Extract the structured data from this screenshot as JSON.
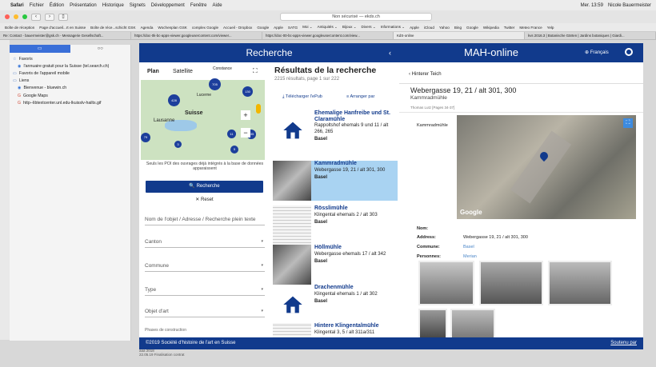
{
  "menubar": {
    "app": "Safari",
    "items": [
      "Fichier",
      "Édition",
      "Présentation",
      "Historique",
      "Signets",
      "Développement",
      "Fenêtre",
      "Aide"
    ],
    "clock": "Mer. 13:59",
    "user": "Nicole Bauermeister"
  },
  "toolbar": {
    "url": "Non sécurisé — ekds.ch"
  },
  "bookmarks": [
    "Boîte de réception",
    "Page d'accueil...rt en Suisse",
    "Boîte de réce...schicht GSK",
    "Agenda",
    "Wochenplan GSK",
    "complex Google",
    "Accueil - Dropbox",
    "Google",
    "Apple",
    "SATG",
    "Moi ⌄",
    "Antiquités ⌄",
    "Bijoux ⌄",
    "Divers ⌄",
    "Informations ⌄",
    "Apple",
    "iCloud",
    "Yahoo",
    "Bing",
    "Google",
    "Wikipedia",
    "Twitter",
    "Meteo France",
    "Yelp"
  ],
  "tabs": [
    {
      "label": "Re: Contact - bauermeister@gsk.ch - Messagerie Gesellschaft...",
      "active": false
    },
    {
      "label": "https://doc-0k-bc-apps-viewer.googleusercontent.com/viewer...",
      "active": false
    },
    {
      "label": "https://doc-00-bc-apps-viewer.googleusercontent.com/view...",
      "active": false
    },
    {
      "label": "KdS-online",
      "active": true
    },
    {
      "label": "kvs 2016.3 | Botanische Gärten | Jardins botaniques | Giardi...",
      "active": false
    }
  ],
  "sidebar": {
    "tab_icons": [
      "book-icon",
      "glasses-icon"
    ],
    "items": [
      {
        "label": "Favoris",
        "icon": "star-icon",
        "indent": 0
      },
      {
        "label": "l'annuaire gratuit pour la Suisse (tel.search.ch)",
        "icon": "globe-icon",
        "indent": 1
      },
      {
        "label": "Favoris de l'appareil mobile",
        "icon": "folder-icon",
        "indent": 0
      },
      {
        "label": "Liens",
        "icon": "folder-icon",
        "indent": 0
      },
      {
        "label": "Bienvenue - bluewin.ch",
        "icon": "globe-icon",
        "indent": 1
      },
      {
        "label": "Google Maps",
        "icon": "g-icon",
        "indent": 1
      },
      {
        "label": "http--libtextcenter.unl.edu-lkuisslv-hailts.gif",
        "icon": "g-icon",
        "indent": 1
      }
    ]
  },
  "search": {
    "header": "Recherche",
    "map_tabs": [
      "Plan",
      "Satellite"
    ],
    "map_labels": [
      "Lausanne",
      "Suisse",
      "Lucerne",
      "Constance"
    ],
    "clusters": [
      "705",
      "428",
      "130",
      "135",
      "11",
      "5",
      "79",
      "3"
    ],
    "map_note": "Seuls les POI des ouvrages déjà intégrés à la base de données apparaissent",
    "search_button": "Recherche",
    "reset_button": "Reset",
    "fields": {
      "text_placeholder": "Nom de l'objet / Adresse / Recherche plein texte",
      "canton": "Canton",
      "commune": "Commune",
      "type": "Type",
      "objet": "Objet d'art",
      "phases": "Phases de construction"
    }
  },
  "results": {
    "title": "Résultats de la recherche",
    "count": "2215 résultats, page 1 sur 222",
    "epub": "Télécharger l'ePub",
    "arrange": "Arranger par",
    "items": [
      {
        "title": "Ehemalige Hanfreibe und St. Claramühle",
        "address": "Rappoltshof ehemals 9 und 11 / alt 266, 265",
        "city": "Basel",
        "thumb": "house"
      },
      {
        "title": "Kammradmühle",
        "address": "Webergasse 19, 21 / alt 301, 300",
        "city": "Basel",
        "thumb": "photo"
      },
      {
        "title": "Rösslimühle",
        "address": "Klingental ehemals 2 / alt 303",
        "city": "Basel",
        "thumb": "drawing"
      },
      {
        "title": "Höllmühle",
        "address": "Webergasse ehemals 17 / alt 342",
        "city": "Basel",
        "thumb": "photo"
      },
      {
        "title": "Drachenmühle",
        "address": "Klingental ehemals 1 / alt 302",
        "city": "Basel",
        "thumb": "house"
      },
      {
        "title": "Hintere Klingentalmühle",
        "address": "Klingental 3, 5 / alt 311a/311",
        "city": "",
        "thumb": "drawing"
      }
    ]
  },
  "mah": {
    "title": "MAH-online",
    "lang": "Français",
    "back": "Hinterer Teich",
    "address": "Webergasse 19, 21 / alt 301, 300",
    "subtitle": "Kammradmühle",
    "ref": "Thomas Lutz [Pages 34-37]",
    "image_label": "Kammradmühle",
    "google": "Google",
    "fields": [
      {
        "label": "Nom:",
        "value": ""
      },
      {
        "label": "Address:",
        "value": "Webergasse 19, 21 / alt 301, 300"
      },
      {
        "label": "Commune:",
        "value": "Basel"
      },
      {
        "label": "Personnes:",
        "value": "Merian"
      }
    ]
  },
  "footer": {
    "copyright": "©2019 Société d'histoire de l'art en Suisse",
    "link": "Soutenu par"
  },
  "dock": {
    "text1": "aaa 2018",
    "text2": "22.05.19 Finalisation contrat"
  }
}
